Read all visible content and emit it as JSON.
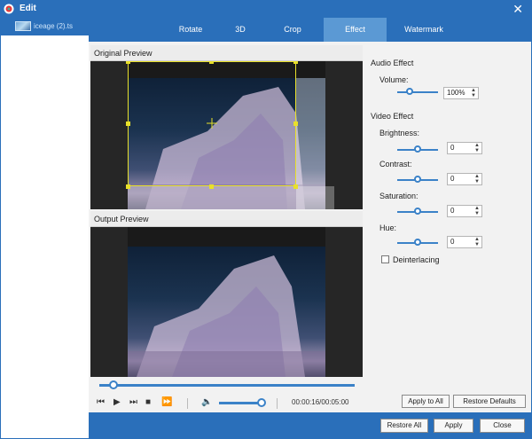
{
  "window": {
    "title": "Edit",
    "close_glyph": "✕"
  },
  "files": [
    {
      "name": "iceage (2).ts"
    }
  ],
  "tabs": [
    {
      "label": "Rotate",
      "active": false
    },
    {
      "label": "3D",
      "active": false
    },
    {
      "label": "Crop",
      "active": false
    },
    {
      "label": "Effect",
      "active": true
    },
    {
      "label": "Watermark",
      "active": false
    }
  ],
  "preview": {
    "original_label": "Original Preview",
    "output_label": "Output Preview"
  },
  "player": {
    "progress_fraction": 0.056,
    "volume_fraction": 0.95,
    "time": "00:00:16/00:05:00",
    "controls": [
      "prev-icon",
      "play-icon",
      "next-icon",
      "stop-icon",
      "skip-icon",
      "volume-icon"
    ]
  },
  "effects": {
    "audio_heading": "Audio Effect",
    "volume_label": "Volume:",
    "volume_value": "100%",
    "video_heading": "Video Effect",
    "brightness_label": "Brightness:",
    "brightness_value": "0",
    "contrast_label": "Contrast:",
    "contrast_value": "0",
    "saturation_label": "Saturation:",
    "saturation_value": "0",
    "hue_label": "Hue:",
    "hue_value": "0",
    "deinterlacing_label": "Deinterlacing",
    "deinterlacing_checked": false
  },
  "buttons": {
    "apply_to_all": "Apply to All",
    "restore_defaults": "Restore Defaults",
    "restore_all": "Restore All",
    "apply": "Apply",
    "close": "Close"
  },
  "colors": {
    "accent": "#2a6fba",
    "slider": "#3b82c8",
    "crop": "#e8e02a"
  }
}
